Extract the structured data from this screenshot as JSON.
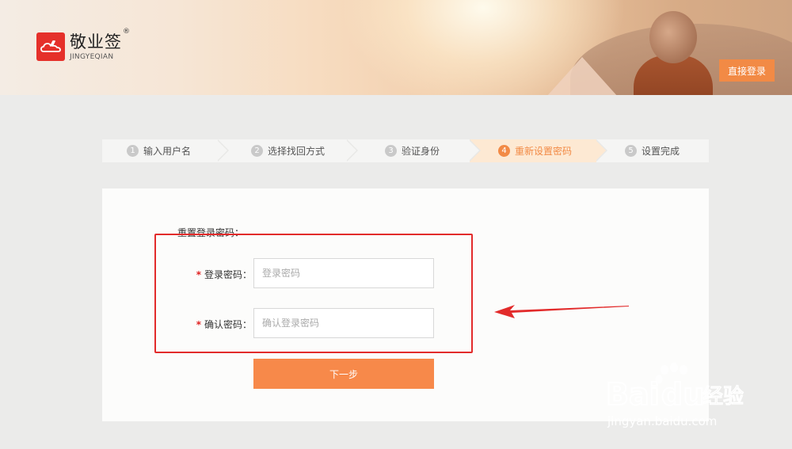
{
  "header": {
    "logo_cn": "敬业签",
    "logo_en": "JINGYEQIAN",
    "logo_reg": "®",
    "direct_login_label": "直接登录"
  },
  "steps": [
    {
      "num": "1",
      "label": "输入用户名",
      "active": false
    },
    {
      "num": "2",
      "label": "选择找回方式",
      "active": false
    },
    {
      "num": "3",
      "label": "验证身份",
      "active": false
    },
    {
      "num": "4",
      "label": "重新设置密码",
      "active": true
    },
    {
      "num": "5",
      "label": "设置完成",
      "active": false
    }
  ],
  "form": {
    "section_title": "重置登录密码：",
    "password": {
      "required_mark": "*",
      "label": "登录密码：",
      "value": "",
      "placeholder": "登录密码"
    },
    "confirm": {
      "required_mark": "*",
      "label": "确认密码：",
      "value": "",
      "placeholder": "确认登录密码"
    },
    "next_label": "下一步"
  },
  "watermark": {
    "brand": "Bai",
    "brand_du": "du",
    "brand_cn": "经验",
    "url": "jingyan.baidu.com"
  },
  "colors": {
    "accent": "#f28a45",
    "required": "#e02020",
    "annotation": "#e22b2b"
  }
}
